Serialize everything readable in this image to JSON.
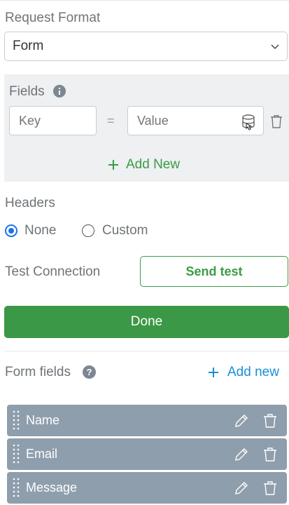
{
  "request_format": {
    "label": "Request Format",
    "selected": "Form"
  },
  "fields": {
    "label": "Fields",
    "key_placeholder": "Key",
    "equals": "=",
    "value_placeholder": "Value",
    "add_new_label": "Add New"
  },
  "headers": {
    "label": "Headers",
    "options": [
      {
        "label": "None",
        "checked": true
      },
      {
        "label": "Custom",
        "checked": false
      }
    ]
  },
  "test_connection": {
    "label": "Test Connection",
    "button": "Send test"
  },
  "done_button": "Done",
  "form_fields": {
    "label": "Form fields",
    "add_new_label": "Add new",
    "rows": [
      {
        "name": "Name"
      },
      {
        "name": "Email"
      },
      {
        "name": "Message"
      }
    ]
  },
  "colors": {
    "accent_green": "#3a9c45",
    "accent_blue": "#1a8fd6",
    "row_bg": "#8f9ead",
    "radio_blue": "#1a73e8"
  }
}
